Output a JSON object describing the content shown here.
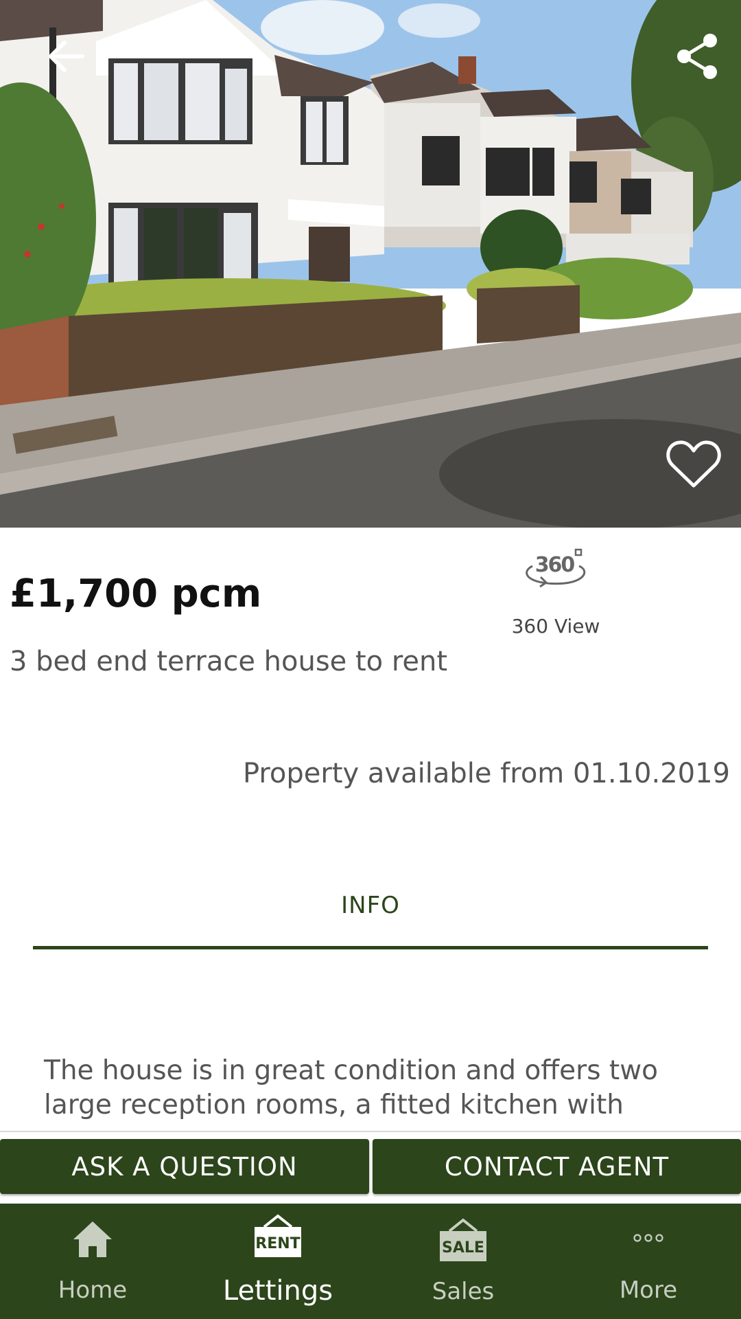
{
  "property": {
    "price": "£1,700 pcm",
    "subtitle": "3 bed end terrace house to rent",
    "availability": "Property available from 01.10.2019",
    "view_360_label": "360 View",
    "view_360_badge": "360"
  },
  "tabs": [
    {
      "label": "INFO",
      "active": true
    }
  ],
  "description": "The house is in great condition and offers two large reception rooms, a fitted kitchen with",
  "actions": {
    "ask_label": "ASK A QUESTION",
    "contact_label": "CONTACT AGENT"
  },
  "nav": {
    "items": [
      {
        "label": "Home",
        "icon": "home-icon"
      },
      {
        "label": "Lettings",
        "icon": "rent-sign-icon",
        "badge": "RENT",
        "active": true
      },
      {
        "label": "Sales",
        "icon": "sale-sign-icon",
        "badge": "SALE"
      },
      {
        "label": "More",
        "icon": "more-dots-icon"
      }
    ]
  },
  "colors": {
    "brand_green": "#2c451b",
    "price_text": "#111111",
    "body_text": "#555555"
  }
}
